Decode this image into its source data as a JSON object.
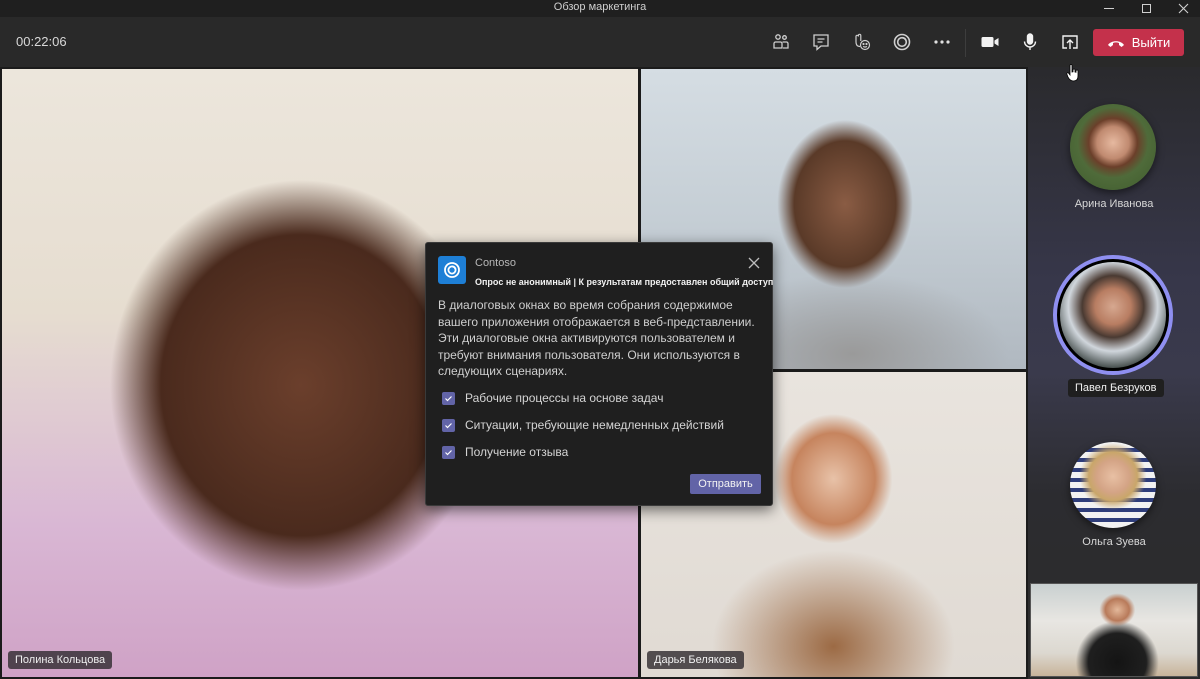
{
  "window": {
    "title": "Обзор маркетинга",
    "controls": [
      "minimize",
      "maximize",
      "close"
    ]
  },
  "toolbar": {
    "timer": "00:22:06",
    "buttons": [
      {
        "name": "participants",
        "icon": "people-icon"
      },
      {
        "name": "chat",
        "icon": "chat-icon"
      },
      {
        "name": "reactions",
        "icon": "raise-hand-emoji-icon"
      },
      {
        "name": "apps",
        "icon": "app-ring-icon"
      },
      {
        "name": "more",
        "icon": "more-icon"
      },
      {
        "name": "camera",
        "icon": "camera-icon"
      },
      {
        "name": "microphone",
        "icon": "mic-icon"
      },
      {
        "name": "share",
        "icon": "share-screen-icon"
      }
    ],
    "leave_label": "Выйти",
    "leave_color": "#c4314b"
  },
  "stage": {
    "tiles": [
      {
        "name": "Полина Кольцова"
      },
      {
        "name": ""
      },
      {
        "name": "Дарья Белякова"
      }
    ]
  },
  "rail": {
    "participants": [
      {
        "name": "Арина Иванова",
        "speaking": false
      },
      {
        "name": "Павел Безруков",
        "speaking": true
      },
      {
        "name": "Ольга Зуева",
        "speaking": false
      }
    ],
    "speaking_ring_color": "#8f8ff0"
  },
  "dialog": {
    "app_name": "Contoso",
    "subtitle": "Опрос не анонимный | К результатам предоставлен общий доступ",
    "body": "В диалоговых окнах во время собрания содержимое вашего приложения отображается в веб-представлении. Эти диалоговые окна активируются пользователем и требуют внимания пользователя. Они используются в следующих сценариях.",
    "options": [
      {
        "label": "Рабочие процессы на основе задач",
        "checked": true
      },
      {
        "label": "Ситуации, требующие немедленных действий",
        "checked": true
      },
      {
        "label": "Получение отзыва",
        "checked": true
      }
    ],
    "submit_label": "Отправить",
    "accent_color": "#6264a7"
  }
}
